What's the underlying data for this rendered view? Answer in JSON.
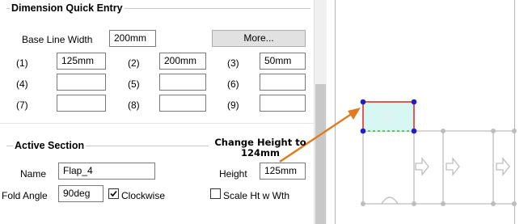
{
  "dimension_quick_entry": {
    "title": "Dimension Quick Entry",
    "base_line_width_label": "Base Line Width",
    "base_line_width_value": "200mm",
    "more_button": "More...",
    "dims": [
      {
        "label": "(1)",
        "value": "125mm"
      },
      {
        "label": "(2)",
        "value": "200mm"
      },
      {
        "label": "(3)",
        "value": "50mm"
      },
      {
        "label": "(4)",
        "value": ""
      },
      {
        "label": "(5)",
        "value": ""
      },
      {
        "label": "(6)",
        "value": ""
      },
      {
        "label": "(7)",
        "value": ""
      },
      {
        "label": "(8)",
        "value": ""
      },
      {
        "label": "(9)",
        "value": ""
      }
    ]
  },
  "active_section": {
    "title": "Active Section",
    "name_label": "Name",
    "name_value": "Flap_4",
    "height_label": "Height",
    "height_value": "125mm",
    "fold_angle_label": "Fold Angle",
    "fold_angle_value": "90deg",
    "clockwise_label": "Clockwise",
    "clockwise_checked": true,
    "scale_label": "Scale Ht w Wth",
    "scale_checked": false
  },
  "annotation": {
    "line1": "Change Height to",
    "line2": "124mm",
    "arrow_color": "#e07b1f"
  },
  "colors": {
    "selected_outline": "#d9271f",
    "selected_fill": "#d6f7f2",
    "handle": "#1f1fc8",
    "dashed_edge": "#2fb82f",
    "drawing_lines": "#bdbdbd"
  }
}
